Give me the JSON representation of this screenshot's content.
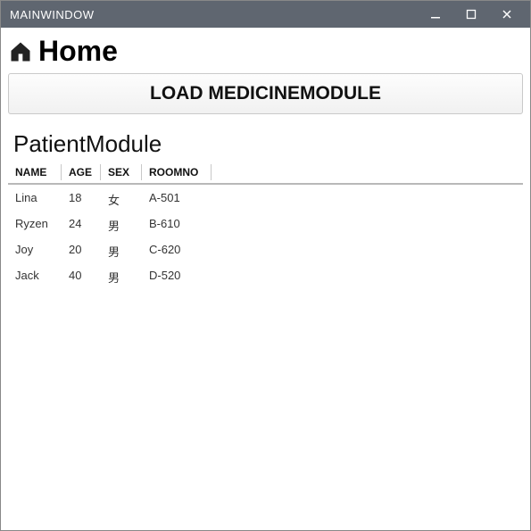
{
  "window": {
    "title": "MAINWINDOW"
  },
  "header": {
    "home_label": "Home"
  },
  "toolbar": {
    "load_button_label": "LOAD MEDICINEMODULE"
  },
  "module": {
    "title": "PatientModule"
  },
  "table": {
    "columns": {
      "name": "NAME",
      "age": "AGE",
      "sex": "SEX",
      "roomno": "ROOMNO"
    },
    "rows": [
      {
        "name": "Lina",
        "age": "18",
        "sex": "女",
        "roomno": "A-501"
      },
      {
        "name": "Ryzen",
        "age": "24",
        "sex": "男",
        "roomno": "B-610"
      },
      {
        "name": "Joy",
        "age": "20",
        "sex": "男",
        "roomno": "C-620"
      },
      {
        "name": "Jack",
        "age": "40",
        "sex": "男",
        "roomno": "D-520"
      }
    ]
  }
}
